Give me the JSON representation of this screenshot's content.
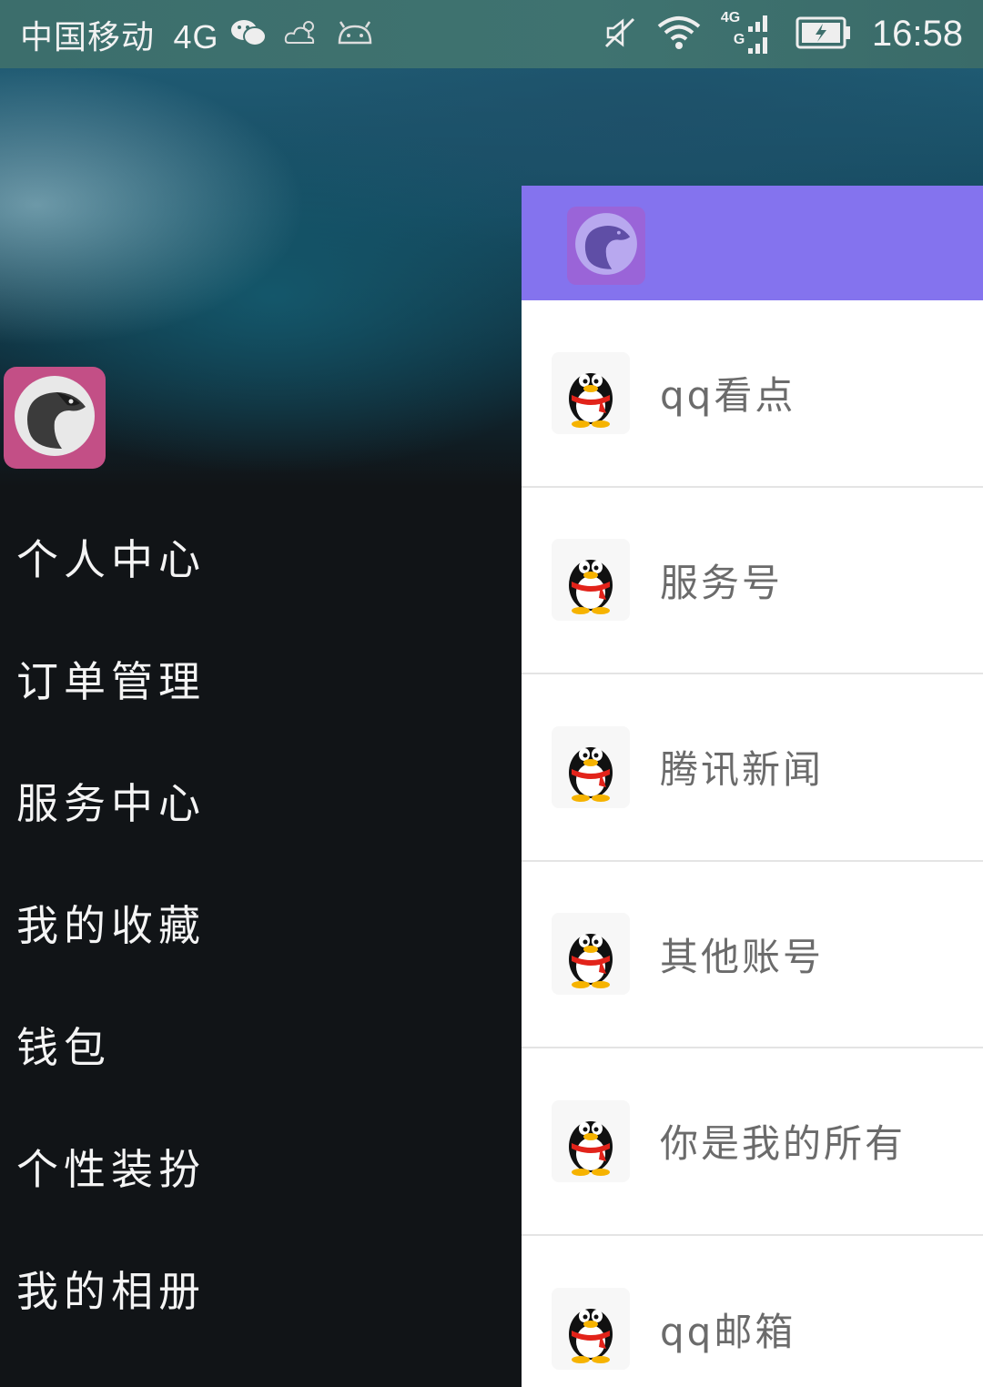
{
  "status_bar": {
    "carrier": "中国移动",
    "network": "4G",
    "signal_network": "4G",
    "signal_secondary": "G",
    "time": "16:58",
    "icons": [
      "wechat-icon",
      "weather-cloud-icon",
      "android-icon",
      "mute-icon",
      "wifi-icon",
      "signal-icon",
      "battery-charging-icon"
    ]
  },
  "drawer": {
    "logo_icon": "ferret-logo-icon",
    "logo_color": "#c34f86",
    "items": [
      {
        "label": "个人中心"
      },
      {
        "label": "订单管理"
      },
      {
        "label": "服务中心"
      },
      {
        "label": "我的收藏"
      },
      {
        "label": "钱包"
      },
      {
        "label": "个性装扮"
      },
      {
        "label": "我的相册"
      }
    ]
  },
  "panel": {
    "header_color": "#8473ee",
    "header_logo_icon": "ferret-logo-icon",
    "items": [
      {
        "label": "qq看点",
        "icon": "qq-penguin-icon"
      },
      {
        "label": "服务号",
        "icon": "qq-penguin-icon"
      },
      {
        "label": "腾讯新闻",
        "icon": "qq-penguin-icon"
      },
      {
        "label": "其他账号",
        "icon": "qq-penguin-icon"
      },
      {
        "label": "你是我的所有",
        "icon": "qq-penguin-icon"
      },
      {
        "label": "qq邮箱",
        "icon": "qq-penguin-icon"
      }
    ]
  }
}
